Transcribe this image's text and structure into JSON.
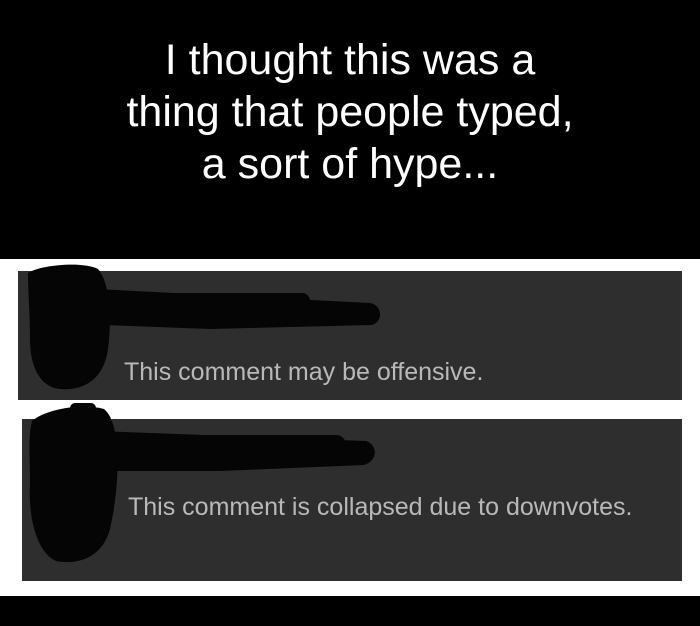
{
  "caption": {
    "lines": [
      "I thought this was a",
      "thing that people typed,",
      "a sort of hype..."
    ]
  },
  "comments": [
    {
      "message": "This comment may be offensive."
    },
    {
      "message": "This comment is collapsed due to downvotes."
    }
  ],
  "colors": {
    "background": "#000000",
    "caption_text": "#ffffff",
    "screenshot_bg": "#ffffff",
    "card_bg": "#2e2e2e",
    "card_text": "#b9b9b9",
    "redaction": "#050505"
  }
}
